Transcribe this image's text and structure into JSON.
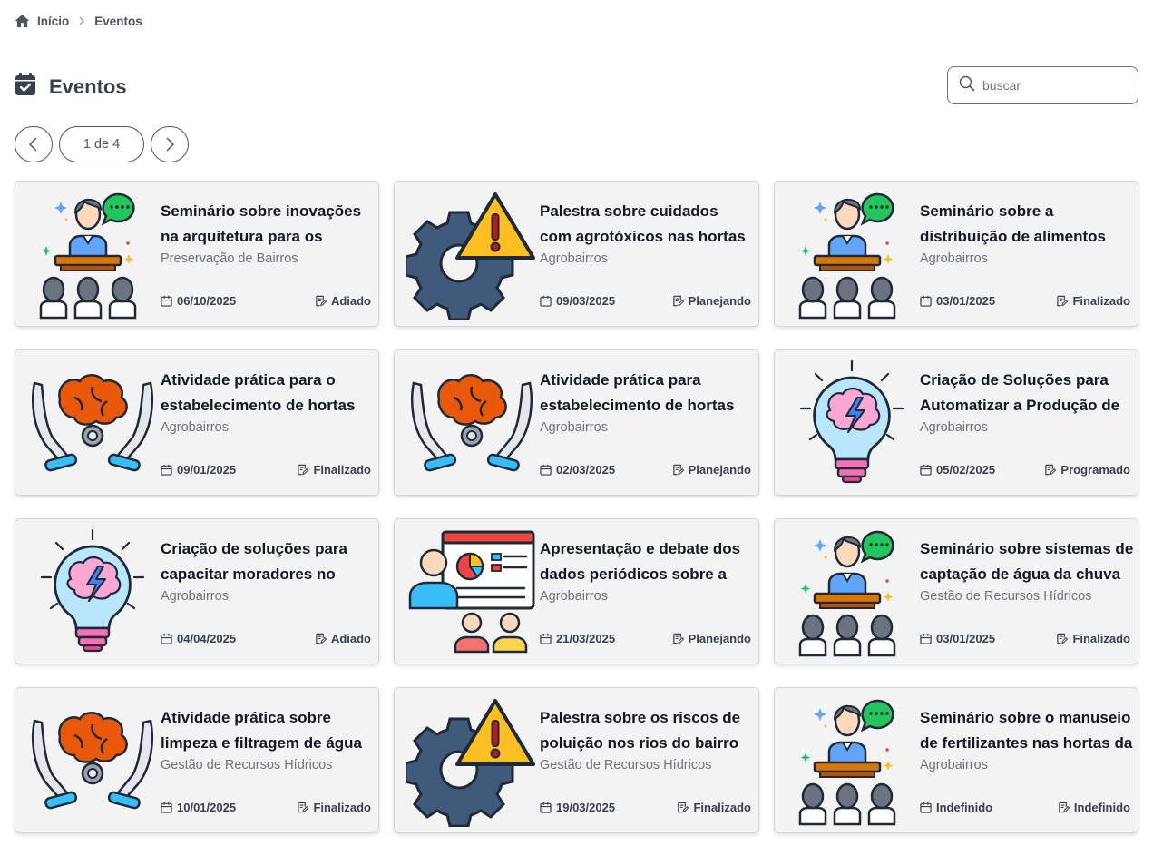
{
  "breadcrumb": {
    "home_label": "Início",
    "current_label": "Eventos",
    "home_icon": "home-icon",
    "separator_icon": "chevron-right-icon"
  },
  "header": {
    "title": "Eventos",
    "title_icon": "calendar-check-icon"
  },
  "search": {
    "placeholder": "buscar",
    "value": "",
    "icon": "search-icon"
  },
  "pagination": {
    "label": "1 de 4",
    "current_page": 1,
    "total_pages": 4,
    "prev_icon": "chevron-left-icon",
    "next_icon": "chevron-right-icon"
  },
  "colors": {
    "card_bg": "#f3f3f3",
    "text_dark": "#111827",
    "text_muted": "#6b7280",
    "accent_blue": "#3b82f6"
  },
  "events": [
    {
      "title": "Seminário sobre inovações na arquitetura para os bairros",
      "category": "Preservação de Bairros",
      "date": "06/10/2025",
      "status": "Adiado",
      "image": "speaker-audience-illustration"
    },
    {
      "title": "Palestra sobre cuidados com agrotóxicos nas hortas do",
      "category": "Agrobairros",
      "date": "09/03/2025",
      "status": "Planejando",
      "image": "gear-warning-illustration"
    },
    {
      "title": "Seminário sobre a distribuição de alimentos nas",
      "category": "Agrobairros",
      "date": "03/01/2025",
      "status": "Finalizado",
      "image": "speaker-audience-illustration"
    },
    {
      "title": "Atividade prática para o estabelecimento de hortas",
      "category": "Agrobairros",
      "date": "09/01/2025",
      "status": "Finalizado",
      "image": "hands-brain-illustration"
    },
    {
      "title": "Atividade prática para estabelecimento de hortas",
      "category": "Agrobairros",
      "date": "02/03/2025",
      "status": "Planejando",
      "image": "hands-brain-illustration"
    },
    {
      "title": "Criação de Soluções para Automatizar a Produção de",
      "category": "Agrobairros",
      "date": "05/02/2025",
      "status": "Programado",
      "image": "lightbulb-brain-illustration"
    },
    {
      "title": "Criação de soluções para capacitar moradores no",
      "category": "Agrobairros",
      "date": "04/04/2025",
      "status": "Adiado",
      "image": "lightbulb-brain-illustration"
    },
    {
      "title": "Apresentação e debate dos dados periódicos sobre a",
      "category": "Agrobairros",
      "date": "21/03/2025",
      "status": "Planejando",
      "image": "presentation-board-illustration"
    },
    {
      "title": "Seminário sobre sistemas de captação de água da chuva",
      "category": "Gestão de Recursos Hídricos",
      "date": "03/01/2025",
      "status": "Finalizado",
      "image": "speaker-audience-illustration"
    },
    {
      "title": "Atividade prática sobre limpeza e filtragem de água",
      "category": "Gestão de Recursos Hídricos",
      "date": "10/01/2025",
      "status": "Finalizado",
      "image": "hands-brain-illustration"
    },
    {
      "title": "Palestra sobre os riscos de poluição nos rios do bairro",
      "category": "Gestão de Recursos Hídricos",
      "date": "19/03/2025",
      "status": "Finalizado",
      "image": "gear-warning-illustration"
    },
    {
      "title": "Seminário sobre o manuseio de fertilizantes nas hortas da",
      "category": "Agrobairros",
      "date": "Indefinido",
      "status": "Indefinido",
      "image": "speaker-audience-illustration"
    }
  ]
}
